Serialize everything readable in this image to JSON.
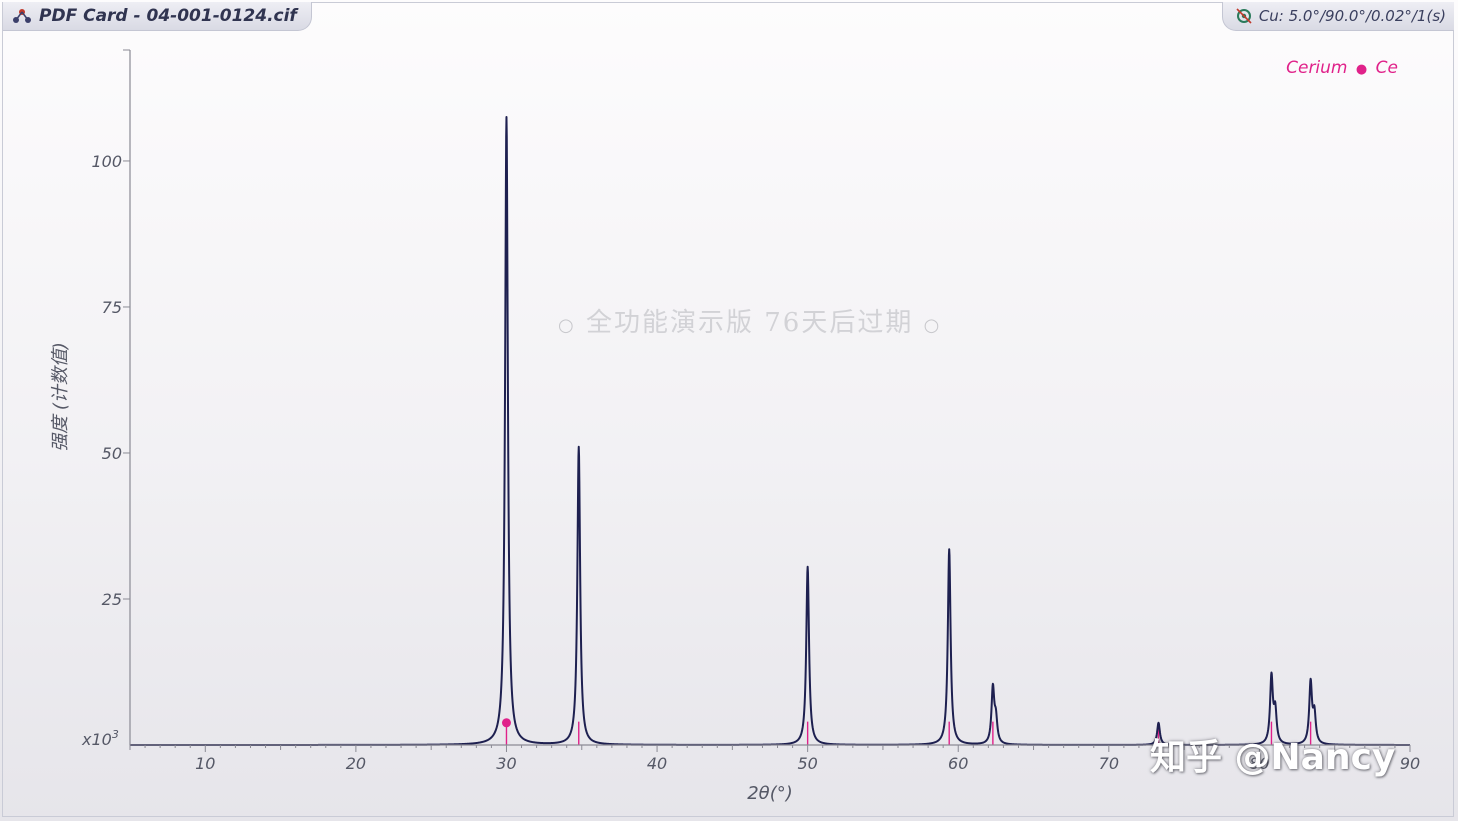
{
  "window": {
    "title": "PDF Card - 04-001-0124.cif",
    "title_icon": "crystal-structure-icon",
    "radiation_icon": "xray-source-icon",
    "radiation": "Cu: 5.0°/90.0°/0.02°/1(s)"
  },
  "legend": {
    "name": "Cerium",
    "separator": "●",
    "symbol": "Ce",
    "color": "#e0218a"
  },
  "watermark": {
    "ring_left": "○",
    "text": "全功能演示版 76天后过期",
    "ring_right": "○"
  },
  "signature": "知乎 @Nancy",
  "chart_data": {
    "type": "line",
    "series": [
      {
        "name": "Cerium ● Ce",
        "color": "#1e2050",
        "peaks": [
          {
            "x": 30.0,
            "y": 107.5
          },
          {
            "x": 34.8,
            "y": 51.0
          },
          {
            "x": 50.0,
            "y": 30.5
          },
          {
            "x": 59.4,
            "y": 33.5
          },
          {
            "x": 62.3,
            "y": 9.5
          },
          {
            "x": 62.5,
            "y": 4.0
          },
          {
            "x": 73.3,
            "y": 3.8
          },
          {
            "x": 80.8,
            "y": 11.5
          },
          {
            "x": 81.05,
            "y": 5.5
          },
          {
            "x": 83.4,
            "y": 10.5
          },
          {
            "x": 83.65,
            "y": 5.0
          }
        ]
      }
    ],
    "reference_lines": [
      30.0,
      34.8,
      50.0,
      59.4,
      62.3,
      73.3,
      80.8,
      83.4
    ],
    "reference_color": "#e0218a",
    "marker": {
      "x": 30.0,
      "y": 3.8
    },
    "xlabel": "2θ(°)",
    "ylabel": "强度 (计数值)",
    "yunit": "x10",
    "yunit_exp": "3",
    "xlim": [
      5.0,
      90.0
    ],
    "ylim": [
      0,
      119
    ],
    "xticks": [
      10,
      20,
      30,
      40,
      50,
      60,
      70,
      80,
      90
    ],
    "xtick_labels": [
      "10",
      "20",
      "30",
      "40",
      "50",
      "60",
      "70",
      "80",
      "90"
    ],
    "yticks": [
      25,
      50,
      75,
      100
    ],
    "ytick_labels": [
      "25",
      "50",
      "75",
      "100"
    ],
    "grid": false
  }
}
